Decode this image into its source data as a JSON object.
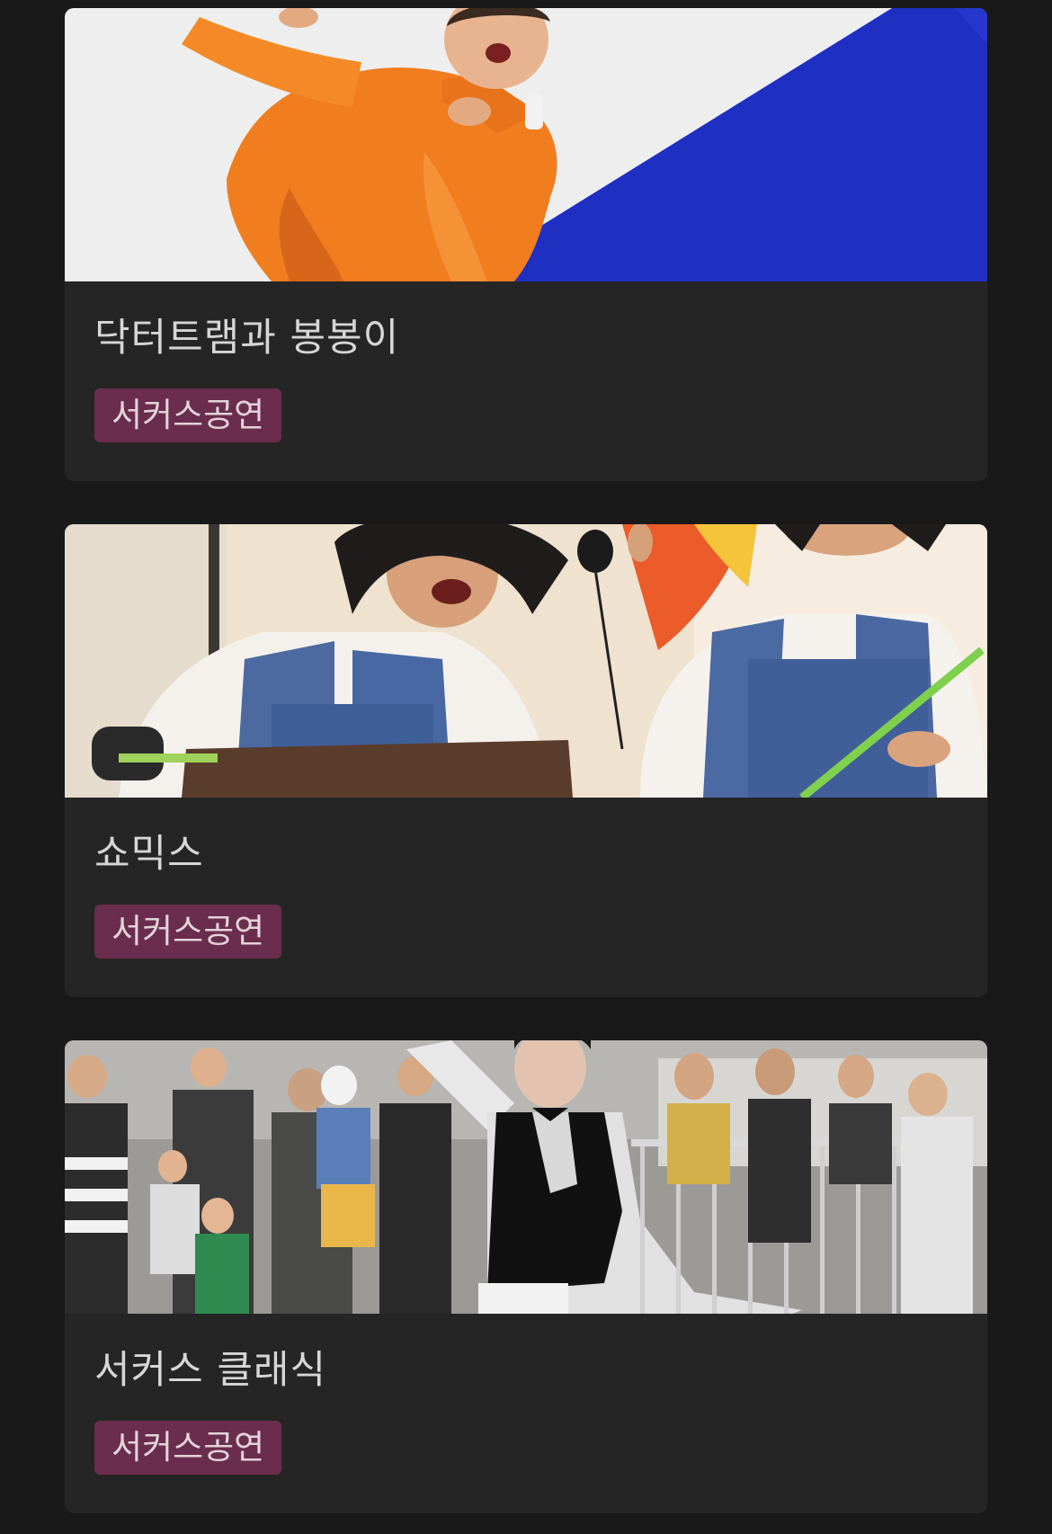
{
  "cards": [
    {
      "title": "닥터트램과 봉봉이",
      "category": "서커스공연",
      "image": "photo-performer-orange-suit"
    },
    {
      "title": "쇼믹스",
      "category": "서커스공연",
      "image": "photo-two-performers-overalls"
    },
    {
      "title": "서커스 클래식",
      "category": "서커스공연",
      "image": "photo-performer-black-vest-crowd"
    }
  ],
  "colors": {
    "background": "#191919",
    "card": "#252525",
    "tag_bg": "#6a2d4d",
    "title": "#d6d6d6"
  }
}
